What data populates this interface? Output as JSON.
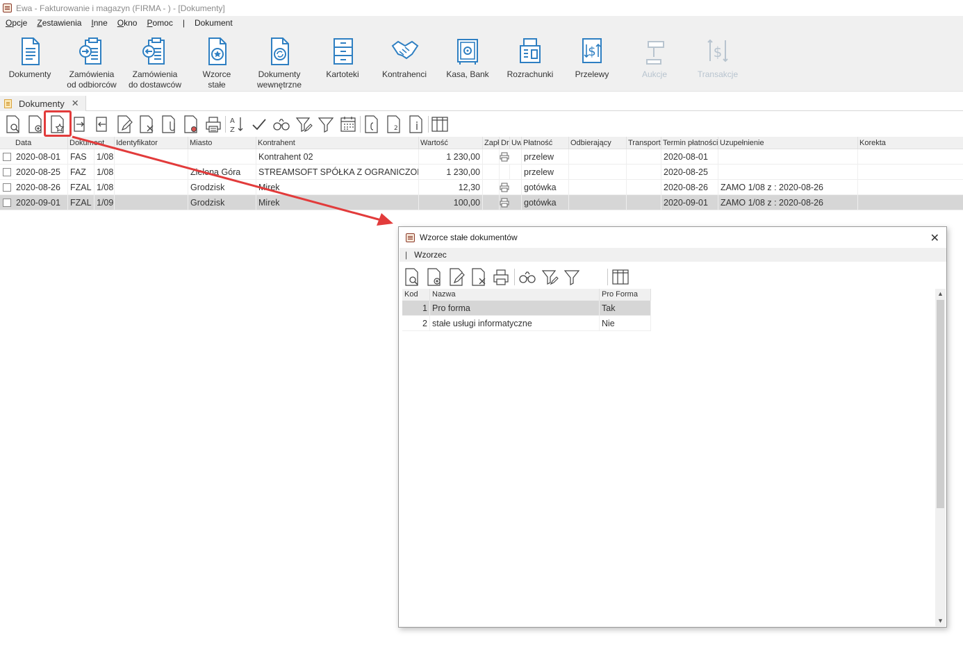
{
  "window": {
    "title": "Ewa - Fakturowanie i magazyn (FIRMA - ) - [Dokumenty]"
  },
  "menu": [
    {
      "label": "Opcje",
      "u": "O",
      "rest": "pcje"
    },
    {
      "label": "Zestawienia",
      "u": "Z",
      "rest": "estawienia"
    },
    {
      "label": "Inne",
      "u": "I",
      "rest": "nne"
    },
    {
      "label": "Okno",
      "u": "O",
      "rest": "kno"
    },
    {
      "label": "Pomoc",
      "u": "P",
      "rest": "omoc"
    },
    {
      "label": "|",
      "u": "",
      "rest": "|"
    },
    {
      "label": "Dokument",
      "u": "",
      "rest": "Dokument"
    }
  ],
  "ribbon": {
    "dokumenty": {
      "l1": "Dokumenty",
      "l2": ""
    },
    "zam_odb": {
      "l1": "Zamówienia",
      "l2": "od odbiorców"
    },
    "zam_dost": {
      "l1": "Zamówienia",
      "l2": "do dostawców"
    },
    "wzorce": {
      "l1": "Wzorce",
      "l2": "stałe"
    },
    "dok_wewn": {
      "l1": "Dokumenty",
      "l2": "wewnętrzne"
    },
    "kartoteki": {
      "l1": "Kartoteki",
      "l2": ""
    },
    "kontrahenci": {
      "l1": "Kontrahenci",
      "l2": ""
    },
    "kasa": {
      "l1": "Kasa, Bank",
      "l2": ""
    },
    "rozrachunki": {
      "l1": "Rozrachunki",
      "l2": ""
    },
    "przelewy": {
      "l1": "Przelewy",
      "l2": ""
    },
    "aukcje": {
      "l1": "Aukcje",
      "l2": ""
    },
    "transakcje": {
      "l1": "Transakcje",
      "l2": ""
    }
  },
  "tab": {
    "label": "Dokumenty",
    "close": "✕"
  },
  "grid": {
    "headers": {
      "data": "Data",
      "dokument": "Dokument",
      "identyfikator": "Identyfikator",
      "miasto": "Miasto",
      "kontrahent": "Kontrahent",
      "wartosc": "Wartość",
      "zapl": "Zapł",
      "dr": "Dr",
      "uw": "Uw",
      "platnosc": "Płatność",
      "odbierajacy": "Odbierający",
      "transport": "Transport",
      "termin": "Termin płatności",
      "uzupelnienie": "Uzupełnienie",
      "korekta": "Korekta"
    },
    "rows": [
      {
        "data": "2020-08-01",
        "typ": "FAS",
        "nr": "1/08",
        "miasto": "",
        "kontrahent": "Kontrahent 02",
        "wartosc": "1 230,00",
        "platnosc": "przelew",
        "termin": "2020-08-01",
        "uzupelnienie": ""
      },
      {
        "data": "2020-08-25",
        "typ": "FAZ",
        "nr": "1/08",
        "miasto": "Zielona Góra",
        "kontrahent": "STREAMSOFT SPÓŁKA Z OGRANICZONĄ",
        "wartosc": "1 230,00",
        "platnosc": "przelew",
        "termin": "2020-08-25",
        "uzupelnienie": ""
      },
      {
        "data": "2020-08-26",
        "typ": "FZAL",
        "nr": "1/08",
        "miasto": "Grodzisk",
        "kontrahent": "Mirek",
        "wartosc": "12,30",
        "platnosc": "gotówka",
        "termin": "2020-08-26",
        "uzupelnienie": "ZAMO 1/08 z : 2020-08-26"
      },
      {
        "data": "2020-09-01",
        "typ": "FZAL",
        "nr": "1/09",
        "miasto": "Grodzisk",
        "kontrahent": "Mirek",
        "wartosc": "100,00",
        "platnosc": "gotówka",
        "termin": "2020-09-01",
        "uzupelnienie": "ZAMO 1/08 z : 2020-08-26"
      }
    ]
  },
  "dialog": {
    "title": "Wzorce stałe dokumentów",
    "close": "✕",
    "menu_sep": "|",
    "menu": "Wzorzec",
    "headers": {
      "kod": "Kod",
      "nazwa": "Nazwa",
      "proforma": "Pro Forma"
    },
    "rows": [
      {
        "kod": "1",
        "nazwa": "Pro forma",
        "proforma": "Tak"
      },
      {
        "kod": "2",
        "nazwa": "stałe usługi informatyczne",
        "proforma": "Nie"
      }
    ]
  },
  "colors": {
    "accent_blue": "#2e7fc2",
    "highlight_red": "#e23b3b",
    "disabled": "#b8c4cf"
  }
}
